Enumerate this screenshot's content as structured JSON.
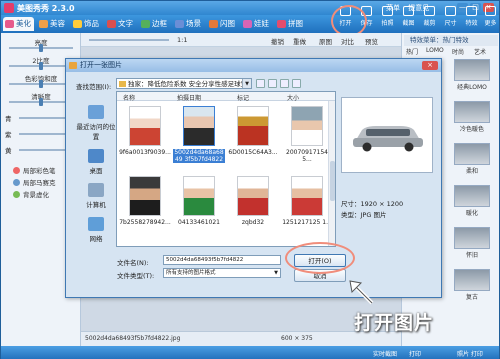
{
  "app": {
    "title": "美图秀秀 2.3.0",
    "menu": [
      "菜单",
      "提意见"
    ],
    "window_buttons": [
      "—",
      "□",
      "×"
    ]
  },
  "tabs": [
    {
      "label": "美化",
      "active": true,
      "color": "#e65a8c"
    },
    {
      "label": "美容",
      "active": false,
      "color": "#f0a04a"
    },
    {
      "label": "饰品",
      "active": false,
      "color": "#ffcc3a"
    },
    {
      "label": "文字",
      "active": false,
      "color": "#d94f4f"
    },
    {
      "label": "边框",
      "active": false,
      "color": "#55b05c"
    },
    {
      "label": "场景",
      "active": false,
      "color": "#6a8ed6"
    },
    {
      "label": "闪图",
      "active": false,
      "color": "#e2793a"
    },
    {
      "label": "娃娃",
      "active": false,
      "color": "#d765b5"
    },
    {
      "label": "拼图",
      "active": false,
      "color": "#e44c6d"
    }
  ],
  "top_tools": [
    "打开",
    "保存",
    "拍照",
    "截图",
    "裁剪",
    "尺寸",
    "特效",
    "更多"
  ],
  "toolbar2": {
    "zoom": "1:1",
    "tools": [
      "撤销",
      "重做",
      "原图",
      "对比",
      "预览"
    ]
  },
  "left_panel": {
    "sliders": [
      "亮度",
      "2比度",
      "色彩饱和度",
      "清晰度"
    ],
    "color_labels": [
      "青",
      "紫",
      "黄"
    ],
    "effects": [
      "局部彩色笔",
      "局部马赛克",
      "背景虚化"
    ]
  },
  "right_panel": {
    "header": "特效菜单：热门特效",
    "tabs": [
      "热门",
      "LOMO",
      "时尚",
      "艺术"
    ],
    "effects": [
      "经典LOMO",
      "冷色暖色",
      "柔和",
      "暖化",
      "怀旧",
      "复古"
    ]
  },
  "statusbar": {
    "filename": "5002d4da68493f5b7fd4822.jpg",
    "size": "600 × 375"
  },
  "bottombar": {
    "left": "实时截图",
    "items": [
      "打印",
      "照片 打印"
    ]
  },
  "dialog": {
    "title": "打开一张图片",
    "lookin_label": "查找范围(I):",
    "lookin_value": "独家：降低危险系数 安全分享性感足球宝贝",
    "places": [
      "最近访问的位置",
      "桌面",
      "计算机",
      "网络"
    ],
    "columns": [
      "名称",
      "拍摄日期",
      "标记",
      "大小"
    ],
    "files": [
      {
        "name": "9f6a0013f9039...",
        "selected": false
      },
      {
        "name": "5002d4da68a6849 3f5b7fd4822",
        "selected": true
      },
      {
        "name": "6D0015C64A3...",
        "selected": false
      },
      {
        "name": "20070917154 5...",
        "selected": false
      },
      {
        "name": "7b2558278942...",
        "selected": false
      },
      {
        "name": "04133461021",
        "selected": false
      },
      {
        "name": "zqbd32",
        "selected": false
      },
      {
        "name": "1251217125 1...",
        "selected": false
      }
    ],
    "preview_meta": {
      "size_label": "尺寸：",
      "size_value": "1920 × 1200",
      "type_label": "类型：",
      "type_value": "JPG 图片"
    },
    "filename_label": "文件名(N):",
    "filename_value": "5002d4da68493f5b7fd4822",
    "filetype_label": "文件类型(T):",
    "filetype_value": "所有支持的图片格式",
    "open_button": "打开(O)",
    "cancel_button": "取消"
  },
  "callout": "打开图片"
}
